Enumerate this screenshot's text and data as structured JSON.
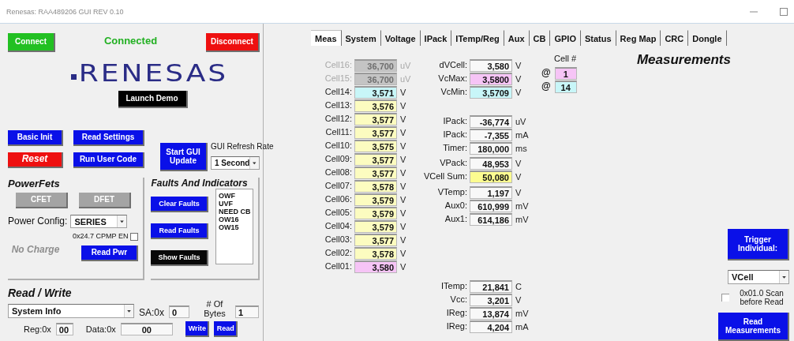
{
  "window": {
    "title": "Renesas: RAA489206 GUI REV 0.10"
  },
  "connection": {
    "connect": "Connect",
    "status": "Connected",
    "connected": true,
    "disconnect": "Disconnect"
  },
  "logo": "RENESAS",
  "launch_demo": "Launch Demo",
  "controls": {
    "basic_init": "Basic Init",
    "read_settings": "Read Settings",
    "reset": "Reset",
    "run_user_code": "Run User Code",
    "start_gui_update": "Start GUI Update",
    "refresh_label": "GUI Refresh Rate",
    "refresh_rate": "1 Second"
  },
  "power_fets": {
    "title": "PowerFets",
    "fets": [
      {
        "label": "CFET",
        "disabled": true
      },
      {
        "label": "DFET",
        "disabled": true
      }
    ],
    "config_label": "Power Config:",
    "config": "SERIES",
    "cpmp_label": "0x24.7 CPMP EN",
    "cpmp_checked": false,
    "charge_status": "No Charge",
    "charging": false,
    "read_pwr": "Read Pwr"
  },
  "faults": {
    "title": "Faults And Indicators",
    "buttons": [
      {
        "label": "Clear Faults",
        "kind": "primary"
      },
      {
        "label": "Read Faults",
        "kind": "primary"
      },
      {
        "label": "Show Faults",
        "kind": "dark"
      }
    ],
    "items": [
      "OWF",
      "UVF",
      "NEED CB",
      "OW16",
      "OW15"
    ]
  },
  "read_write": {
    "title": "Read / Write",
    "register_set": "System Info",
    "sa_label": "SA:0x",
    "sa": "0",
    "bytes_label": "# Of Bytes",
    "bytes": "1",
    "reg_label": "Reg:0x",
    "reg": "00",
    "data_label": "Data:0x",
    "data": "00",
    "buttons": [
      "Write",
      "Read"
    ]
  },
  "tabs": [
    {
      "label": "Meas",
      "selected": true
    },
    {
      "label": "System",
      "selected": false
    },
    {
      "label": "Voltage",
      "selected": false
    },
    {
      "label": "IPack",
      "selected": false
    },
    {
      "label": "ITemp/Reg",
      "selected": false
    },
    {
      "label": "Aux",
      "selected": false
    },
    {
      "label": "CB",
      "selected": false
    },
    {
      "label": "GPIO",
      "selected": false
    },
    {
      "label": "Status",
      "selected": false
    },
    {
      "label": "Reg Map",
      "selected": false
    },
    {
      "label": "CRC",
      "selected": false
    },
    {
      "label": "Dongle",
      "selected": false
    }
  ],
  "measurements": {
    "title": "Measurements",
    "cells": [
      {
        "label": "Cell16:",
        "value": "36,700",
        "unit": "uV",
        "color": "#c4c4c4",
        "disabled": true
      },
      {
        "label": "Cell15:",
        "value": "36,700",
        "unit": "uV",
        "color": "#c4c4c4",
        "disabled": true
      },
      {
        "label": "Cell14:",
        "value": "3,571",
        "unit": "V",
        "color": "#c8f6f8",
        "disabled": false
      },
      {
        "label": "Cell13:",
        "value": "3,576",
        "unit": "V",
        "color": "#fcfcc0",
        "disabled": false
      },
      {
        "label": "Cell12:",
        "value": "3,577",
        "unit": "V",
        "color": "#fcfcc0",
        "disabled": false
      },
      {
        "label": "Cell11:",
        "value": "3,577",
        "unit": "V",
        "color": "#fcfcc0",
        "disabled": false
      },
      {
        "label": "Cell10:",
        "value": "3,575",
        "unit": "V",
        "color": "#fcfcc0",
        "disabled": false
      },
      {
        "label": "Cell09:",
        "value": "3,577",
        "unit": "V",
        "color": "#fcfcc0",
        "disabled": false
      },
      {
        "label": "Cell08:",
        "value": "3,577",
        "unit": "V",
        "color": "#fcfcc0",
        "disabled": false
      },
      {
        "label": "Cell07:",
        "value": "3,578",
        "unit": "V",
        "color": "#fcfcc0",
        "disabled": false
      },
      {
        "label": "Cell06:",
        "value": "3,579",
        "unit": "V",
        "color": "#fcfcc0",
        "disabled": false
      },
      {
        "label": "Cell05:",
        "value": "3,579",
        "unit": "V",
        "color": "#fcfcc0",
        "disabled": false
      },
      {
        "label": "Cell04:",
        "value": "3,579",
        "unit": "V",
        "color": "#fcfcc0",
        "disabled": false
      },
      {
        "label": "Cell03:",
        "value": "3,577",
        "unit": "V",
        "color": "#fcfcc0",
        "disabled": false
      },
      {
        "label": "Cell02:",
        "value": "3,578",
        "unit": "V",
        "color": "#fcfcc0",
        "disabled": false
      },
      {
        "label": "Cell01:",
        "value": "3,580",
        "unit": "V",
        "color": "#f6c4f6",
        "disabled": false
      }
    ],
    "readings": [
      [
        {
          "label": "dVCell:",
          "value": "3,580",
          "unit": "V",
          "color": "#f8f8f8"
        },
        {
          "label": "VcMax:",
          "value": "3,5800",
          "unit": "V",
          "color": "#f6c4f6"
        },
        {
          "label": "VcMin:",
          "value": "3,5709",
          "unit": "V",
          "color": "#c8f6f8"
        }
      ],
      [
        {
          "label": "IPack:",
          "value": "-36,774",
          "unit": "uV",
          "color": "#f8f8f8"
        },
        {
          "label": "IPack:",
          "value": "-7,355",
          "unit": "mA",
          "color": "#f8f8f8"
        },
        {
          "label": "Timer:",
          "value": "180,000",
          "unit": "ms",
          "color": "#f8f8f8"
        }
      ],
      [
        {
          "label": "VPack:",
          "value": "48,953",
          "unit": "V",
          "color": "#f8f8f8"
        },
        {
          "label": "VCell Sum:",
          "value": "50,080",
          "unit": "V",
          "color": "#fcfc90"
        }
      ],
      [
        {
          "label": "VTemp:",
          "value": "1,197",
          "unit": "V",
          "color": "#f8f8f8"
        },
        {
          "label": "Aux0:",
          "value": "610,999",
          "unit": "mV",
          "color": "#f8f8f8"
        },
        {
          "label": "Aux1:",
          "value": "614,186",
          "unit": "mV",
          "color": "#f8f8f8"
        }
      ],
      [
        {
          "label": "ITemp:",
          "value": "21,841",
          "unit": "C",
          "color": "#f8f8f8"
        },
        {
          "label": "Vcc:",
          "value": "3,201",
          "unit": "V",
          "color": "#f8f8f8"
        },
        {
          "label": "IReg:",
          "value": "13,874",
          "unit": "mV",
          "color": "#f8f8f8"
        },
        {
          "label": "IReg:",
          "value": "4,204",
          "unit": "mA",
          "color": "#f8f8f8"
        }
      ]
    ],
    "cell_numbers": {
      "heading": "Cell #",
      "rows": [
        {
          "at": "@",
          "value": "1",
          "color": "#f6c4f6"
        },
        {
          "at": "@",
          "value": "14",
          "color": "#c8f6f8"
        }
      ]
    },
    "trigger": "Trigger Individual:",
    "trigger_select": "VCell",
    "scan": {
      "label": "0x01.0 Scan before Read",
      "checked": false
    },
    "read_measurements": "Read Measurements"
  }
}
